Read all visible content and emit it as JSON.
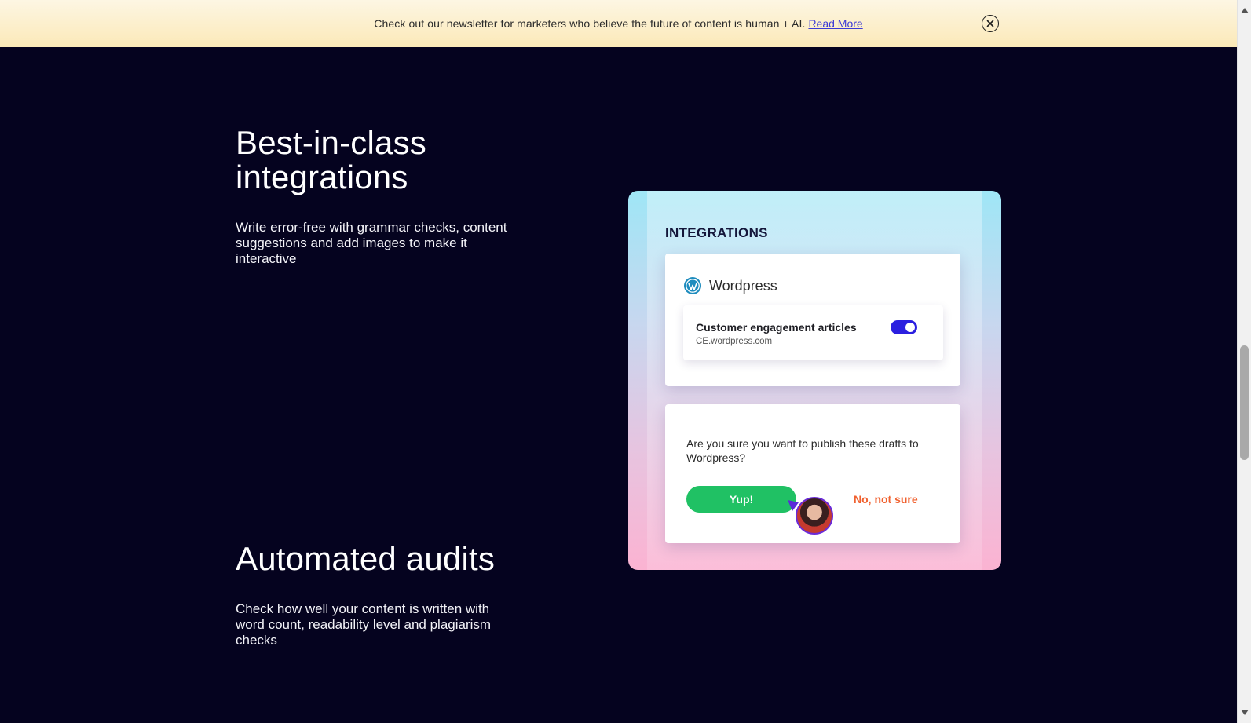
{
  "banner": {
    "message": "Check out our newsletter for marketers who believe the future of content is human + AI.",
    "link_label": "Read More",
    "close_icon": "close-circle-icon"
  },
  "features": [
    {
      "title": "Best-in-class integrations",
      "description": "Write error-free with grammar checks, content suggestions and add images to make it interactive"
    },
    {
      "title": "Automated audits",
      "description": "Check how well your content is written with word count, readability level and plagiarism checks"
    }
  ],
  "integrations_panel": {
    "title": "INTEGRATIONS",
    "platform": {
      "icon": "wordpress-icon",
      "name": "Wordpress",
      "brand_color": "#1e8cbe"
    },
    "site": {
      "name": "Customer engagement articles",
      "url": "CE.wordpress.com",
      "enabled": true,
      "toggle_color": "#2b1fe0"
    },
    "confirm": {
      "question": "Are you sure you want to publish these drafts to Wordpress?",
      "yes_label": "Yup!",
      "no_label": "No, not sure",
      "yes_color": "#20c164",
      "no_color": "#f0612f"
    }
  }
}
